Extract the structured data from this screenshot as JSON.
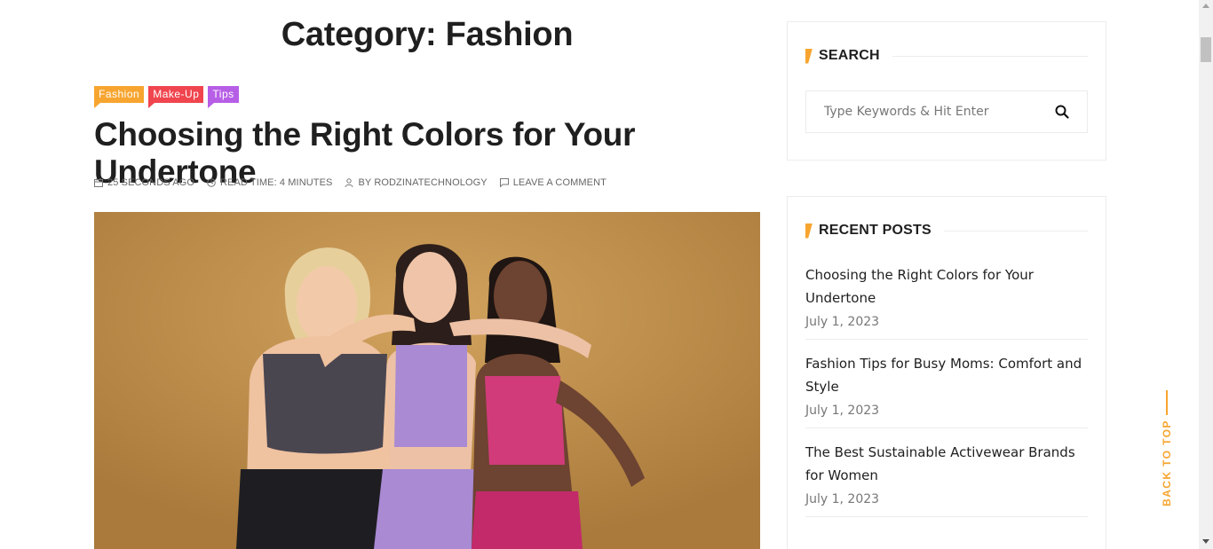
{
  "archive": {
    "title": "Category: Fashion"
  },
  "post": {
    "categories": [
      "Fashion",
      "Make-Up",
      "Tips"
    ],
    "title": "Choosing the Right Colors for Your Undertone",
    "meta": {
      "date": "25 SECONDS AGO",
      "read_time": "READ TIME: 4 MINUTES",
      "author": "BY RODZINATECHNOLOGY",
      "comments": "LEAVE A COMMENT"
    }
  },
  "sidebar": {
    "search": {
      "title": "SEARCH",
      "placeholder": "Type Keywords & Hit Enter"
    },
    "recent_posts": {
      "title": "RECENT POSTS",
      "items": [
        {
          "title": "Choosing the Right Colors for Your Undertone",
          "date": "July 1, 2023"
        },
        {
          "title": "Fashion Tips for Busy Moms: Comfort and Style",
          "date": "July 1, 2023"
        },
        {
          "title": "The Best Sustainable Activewear Brands for Women",
          "date": "July 1, 2023"
        }
      ]
    }
  },
  "back_to_top": "BACK TO TOP",
  "colors": {
    "accent": "#f7a530",
    "tag_fashion": "#f7a530",
    "tag_makeup": "#f0454e",
    "tag_tips": "#b75ee6",
    "image_background": "#c99a56"
  },
  "icons": [
    "calendar-icon",
    "clock-icon",
    "user-icon",
    "comment-icon",
    "search-icon"
  ]
}
